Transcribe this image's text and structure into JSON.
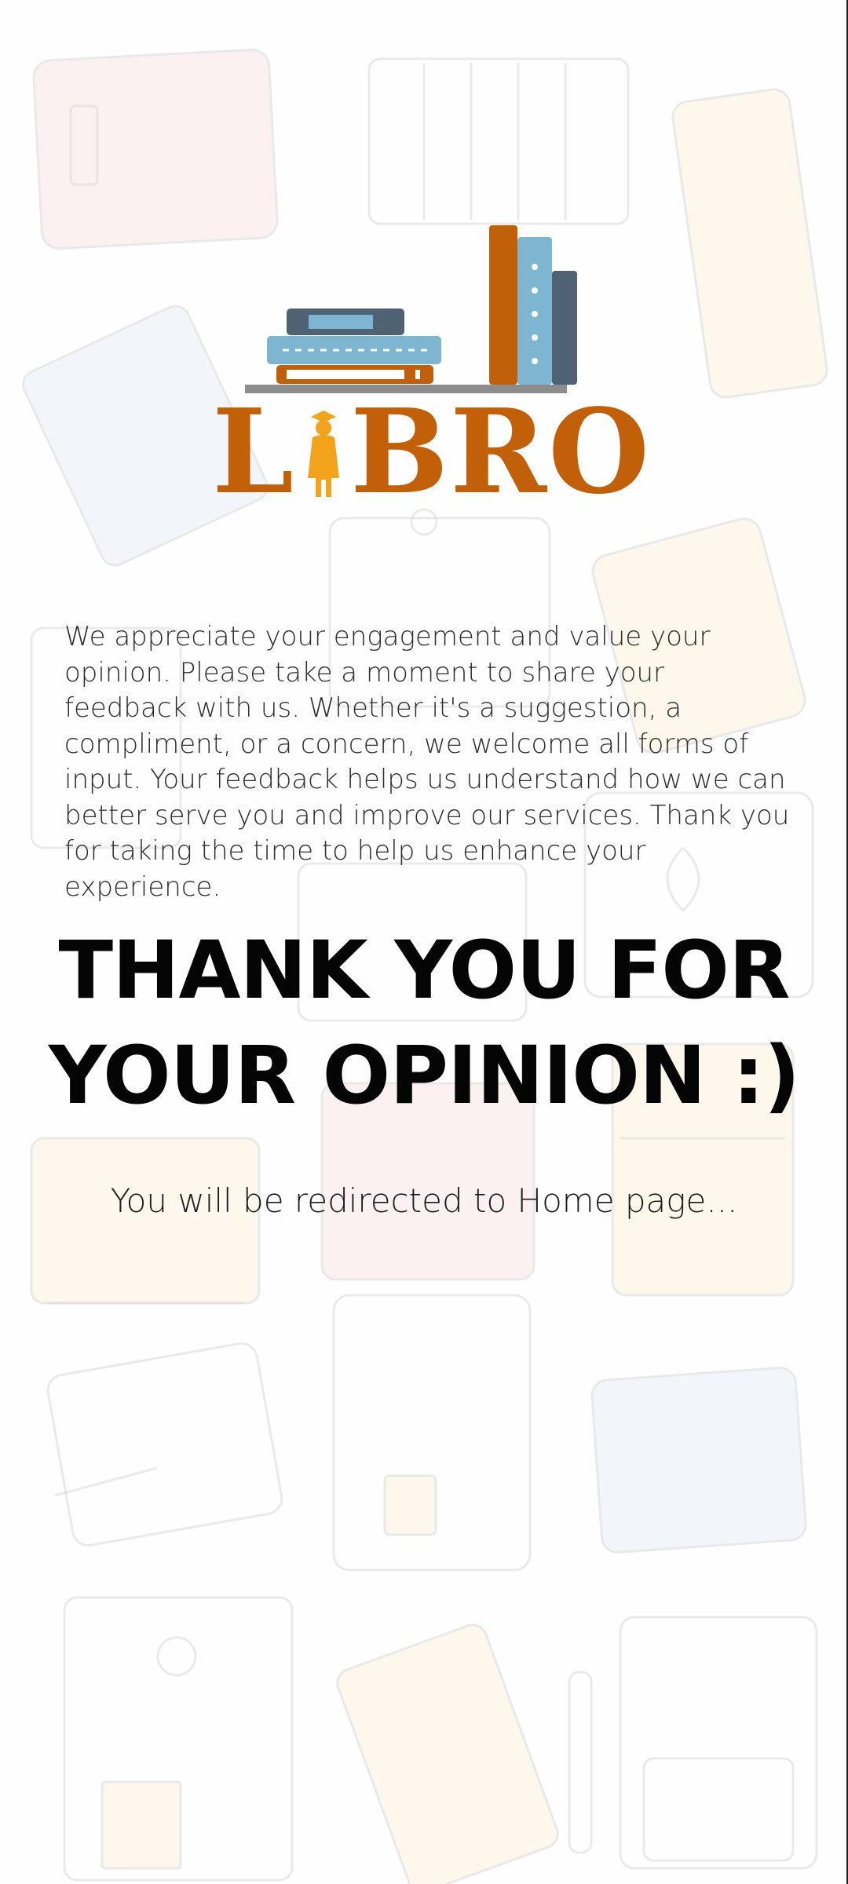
{
  "logo": {
    "wordmark_left": "L",
    "wordmark_right": "BRO",
    "alt_name": "LIBRO",
    "colors": {
      "orange": "#c2600a",
      "figure_yellow": "#f2a31b",
      "blue": "#7eb6d2",
      "slate": "#4f6274",
      "shelf": "#8c8c8c"
    }
  },
  "intro": {
    "paragraph": "We appreciate your engagement and value your opinion. Please take a moment to share your feedback with us. Whether it's a suggestion, a compliment, or a concern, we welcome all forms of input. Your feedback helps us understand how we can better serve you and improve our services. Thank you for taking the time to help us enhance your experience."
  },
  "confirmation": {
    "headline_line1": "THANK YOU FOR",
    "headline_line2": "YOUR OPINION :)",
    "redirect_message": "You will be redirected to Home page..."
  },
  "background": {
    "pattern_icon": "notebook-doodle-pattern"
  }
}
